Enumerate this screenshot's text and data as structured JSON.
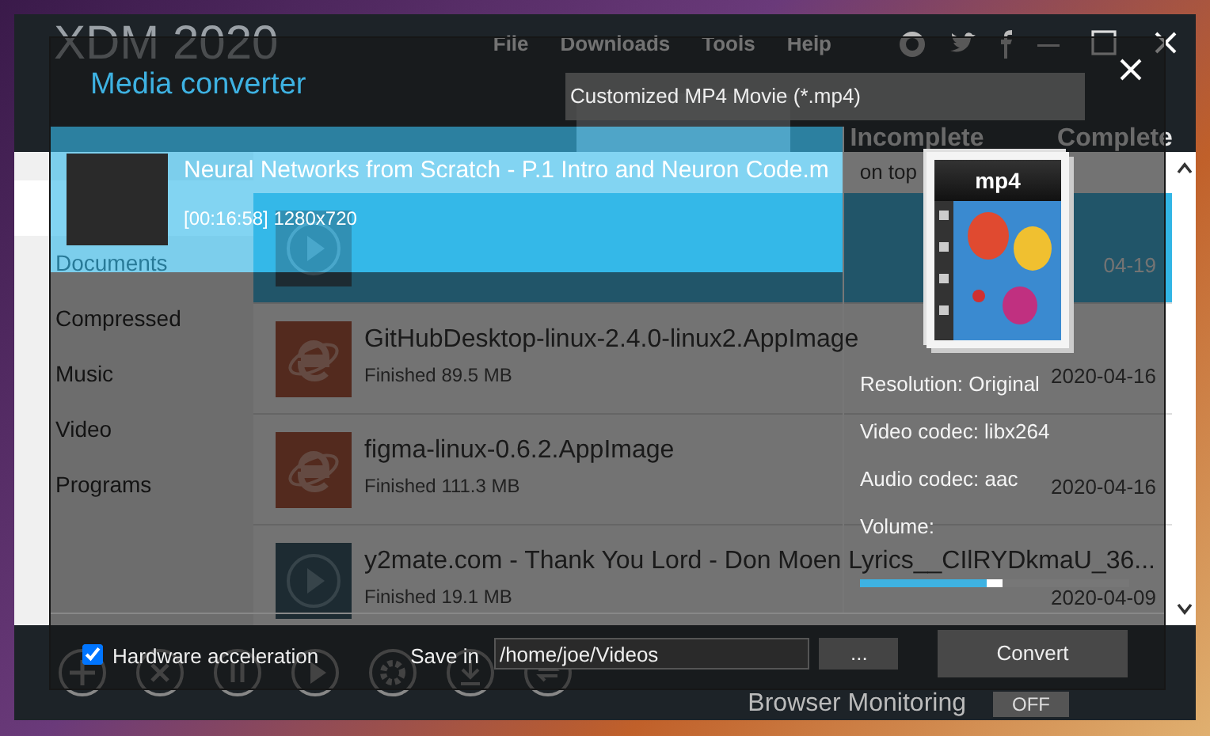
{
  "app": {
    "title": "XDM 2020",
    "menu": [
      "File",
      "Downloads",
      "Tools",
      "Help"
    ],
    "tabs": [
      {
        "selected": true
      },
      {
        "label": "Incomplete",
        "selected": false
      },
      {
        "label": "Complete",
        "selected": false
      }
    ],
    "categories": [
      {
        "selected": true
      },
      {
        "label": "Documents",
        "selected": false
      },
      {
        "label": "Compressed",
        "selected": false
      },
      {
        "label": "Music",
        "selected": false
      },
      {
        "label": "Video",
        "selected": false
      },
      {
        "label": "Programs",
        "selected": false
      }
    ],
    "sort": "on top",
    "downloads": [
      {
        "kind": "video",
        "date": "04-19",
        "selected": true
      },
      {
        "kind": "web",
        "name": "GitHubDesktop-linux-2.4.0-linux2.AppImage",
        "status": "Finished 89.5 MB",
        "date": "2020-04-16",
        "selected": false
      },
      {
        "kind": "web",
        "name": "figma-linux-0.6.2.AppImage",
        "status": "Finished 111.3 MB",
        "date": "2020-04-16",
        "selected": false
      },
      {
        "kind": "video",
        "name": "y2mate.com - Thank You Lord - Don Moen Lyrics__CIlRYDkmaU_36...",
        "status": "Finished 19.1 MB",
        "date": "2020-04-09",
        "selected": false
      }
    ],
    "browser_monitoring": {
      "label": "Browser Monitoring",
      "value": "OFF"
    }
  },
  "dialog": {
    "title": "Media converter",
    "format": "Customized MP4 Movie (*.mp4)",
    "source": {
      "title": "Neural Networks from Scratch - P.1 Intro and Neuron Code.m",
      "info": "[00:16:58] 1280x720"
    },
    "format_icon": "mp4",
    "details": [
      "Resolution: Original",
      "Video codec: libx264",
      "Audio codec: aac"
    ],
    "volume": {
      "label": "Volume:",
      "level": 0.47
    },
    "hardware_acceleration": {
      "label": "Hardware acceleration",
      "checked": true
    },
    "save_in": {
      "label": "Save in",
      "value": "/home/joe/Videos"
    },
    "browse_button": "...",
    "convert_button": "Convert"
  }
}
